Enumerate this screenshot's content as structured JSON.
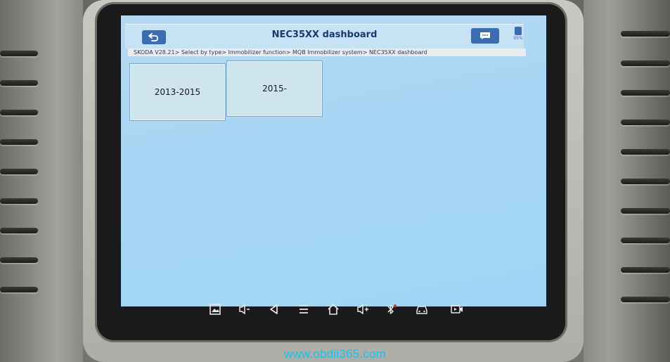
{
  "header": {
    "title": "NEC35XX dashboard",
    "back_icon": "back-arrow-icon",
    "message_icon": "chat-bubble-icon",
    "status_icon": "battery-status-icon",
    "status_text": "95%"
  },
  "breadcrumb": "SKODA V28.21> Select by type> Immobilizer function> MQB Immobilizer system> NEC35XX dashboard",
  "options": [
    {
      "label": "2013-2015"
    },
    {
      "label": "2015-"
    }
  ],
  "navbar": {
    "icons": [
      "screenshot-icon",
      "volume-down-icon",
      "back-triangle-icon",
      "menu-icon",
      "home-icon",
      "volume-up-icon",
      "bluetooth-icon",
      "vci-car-icon",
      "video-record-icon"
    ]
  },
  "watermark": "www.obdii365.com",
  "colors": {
    "screen_bg": "#a8d6f4",
    "header_button": "#3c6db0",
    "title_text": "#173a6e",
    "tile_bg": "#cfe5ee",
    "watermark": "#19c2e8"
  }
}
